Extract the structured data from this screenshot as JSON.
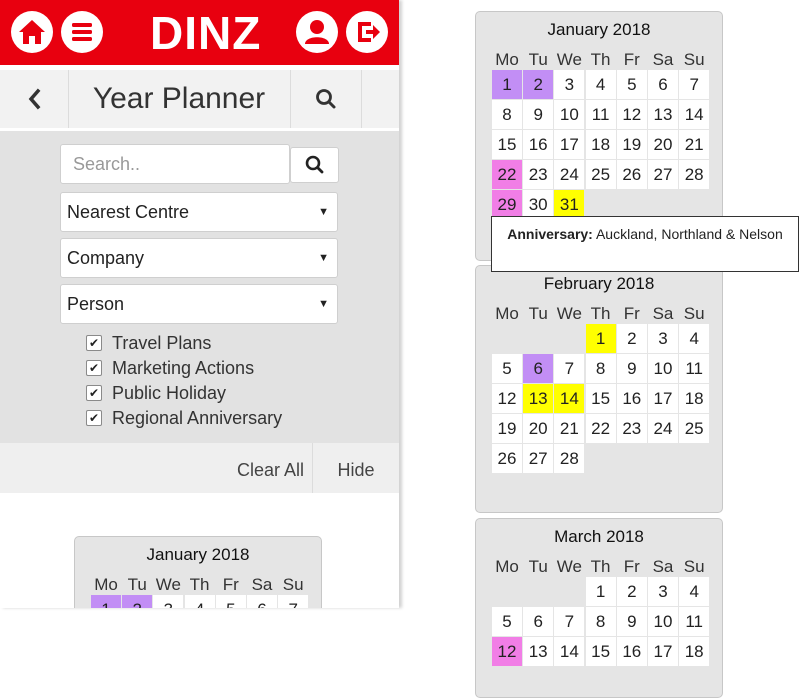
{
  "app": {
    "brand": "DINZ"
  },
  "topbar": {
    "icons": [
      "home-icon",
      "menu-icon",
      "profile-icon",
      "logout-icon"
    ],
    "color": "#e8000f"
  },
  "subheader": {
    "title": "Year Planner"
  },
  "filters": {
    "search_placeholder": "Search..",
    "selects": [
      {
        "value": "Nearest Centre"
      },
      {
        "value": "Company"
      },
      {
        "value": "Person"
      }
    ],
    "checkboxes": [
      {
        "label": "Travel Plans",
        "checked": true
      },
      {
        "label": "Marketing Actions",
        "checked": true
      },
      {
        "label": "Public Holiday",
        "checked": true
      },
      {
        "label": "Regional Anniversary",
        "checked": true
      }
    ]
  },
  "actions": {
    "clear_all": "Clear All",
    "hide": "Hide"
  },
  "weekdays": [
    "Mo",
    "Tu",
    "We",
    "Th",
    "Fr",
    "Sa",
    "Su"
  ],
  "legend_colors": {
    "purple": "#c28ef5",
    "pink": "#f17ee6",
    "yellow": "#ffff00"
  },
  "calendars": {
    "left": {
      "title": "January 2018",
      "offset": 0,
      "days_visible": 21,
      "highlights": {
        "1": "purple",
        "2": "purple"
      }
    },
    "jan": {
      "title": "January 2018",
      "offset": 0,
      "days_visible": 31,
      "highlights": {
        "1": "purple",
        "2": "purple",
        "22": "pink",
        "29": "pink",
        "31": "yellow"
      }
    },
    "feb": {
      "title": "February 2018",
      "offset": 3,
      "days_visible": 28,
      "highlights": {
        "1": "yellow",
        "6": "purple",
        "13": "yellow",
        "14": "yellow"
      }
    },
    "mar": {
      "title": "March 2018",
      "offset": 3,
      "days_visible": 18,
      "highlights": {
        "12": "pink"
      }
    }
  },
  "tooltip": {
    "label": "Anniversary:",
    "text": "Auckland, Northland & Nelson"
  }
}
